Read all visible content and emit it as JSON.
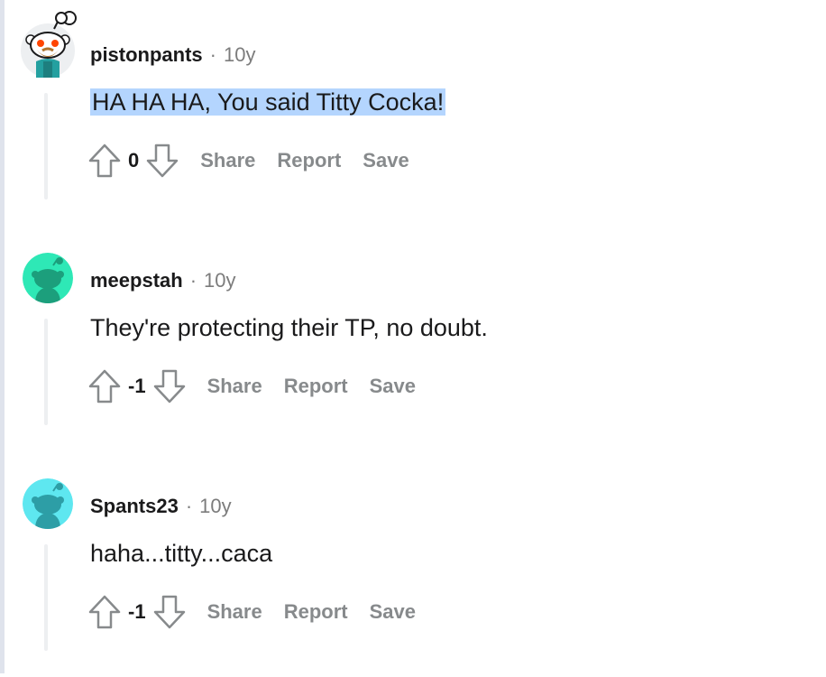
{
  "comments": [
    {
      "username": "pistonpants",
      "separator": "·",
      "age": "10y",
      "body": "HA HA HA, You said Titty Cocka!",
      "score": "0",
      "actions": {
        "share": "Share",
        "report": "Report",
        "save": "Save"
      },
      "avatar_icon": "snoo-custom-avatar-icon",
      "body_selected": true
    },
    {
      "username": "meepstah",
      "separator": "·",
      "age": "10y",
      "body": "They're protecting their TP, no doubt.",
      "score": "-1",
      "actions": {
        "share": "Share",
        "report": "Report",
        "save": "Save"
      },
      "avatar_icon": "snoo-default-avatar-icon",
      "avatar_color": "#2ee8b6"
    },
    {
      "username": "Spants23",
      "separator": "·",
      "age": "10y",
      "body": "haha...titty...caca",
      "score": "-1",
      "actions": {
        "share": "Share",
        "report": "Report",
        "save": "Save"
      },
      "avatar_icon": "snoo-default-avatar-icon",
      "avatar_color": "#5ee7f0"
    }
  ],
  "colors": {
    "selection": "#b4d5fe",
    "action_gray": "#878a8c",
    "text": "#1a1a1b"
  }
}
